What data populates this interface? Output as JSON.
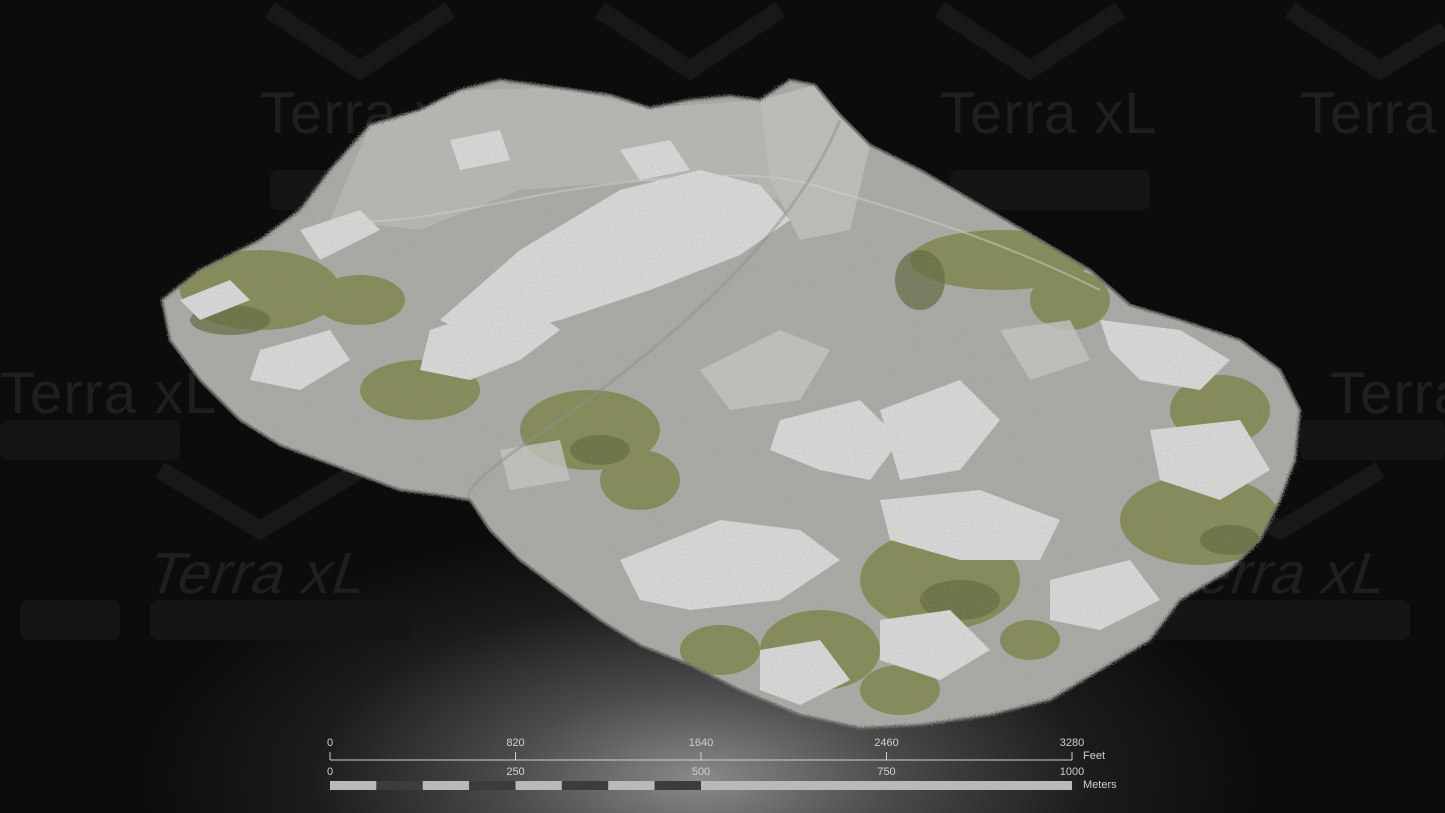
{
  "watermark": {
    "text": "Terra xL"
  },
  "scale_bar": {
    "feet": {
      "ticks": [
        "0",
        "820",
        "1640",
        "2460",
        "3280"
      ],
      "unit": "Feet"
    },
    "meters": {
      "ticks": [
        "0",
        "250",
        "500",
        "750",
        "1000"
      ],
      "unit": "Meters",
      "segments": 16
    }
  },
  "colors": {
    "background": "#0c0c0c",
    "terrain_rock": "#a9a9a5",
    "terrain_snow": "#dcdcdc",
    "terrain_vegetation": "#7d8443",
    "scale_light": "#b9b9b9",
    "scale_dark": "#3c3c3c"
  }
}
